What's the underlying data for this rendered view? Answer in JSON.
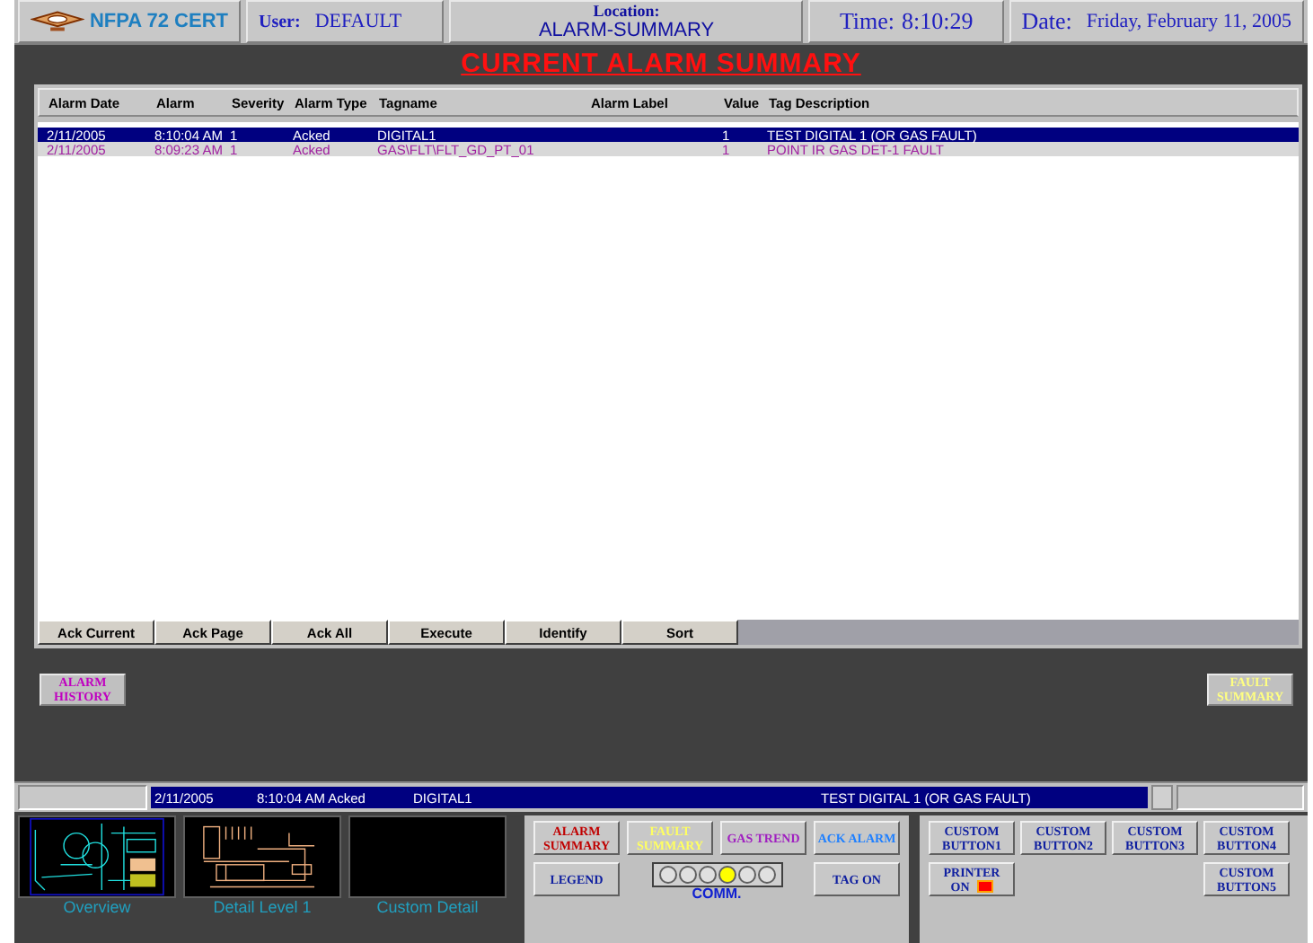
{
  "header": {
    "logo_text": "NFPA 72 CERT",
    "user_label": "User:",
    "user": "DEFAULT",
    "location_label": "Location:",
    "location": "ALARM-SUMMARY",
    "time_label": "Time:",
    "time": "8:10:29",
    "date_label": "Date:",
    "date": "Friday, February 11, 2005"
  },
  "title": "CURRENT ALARM SUMMARY",
  "table": {
    "columns": [
      "Alarm Date",
      "Alarm",
      "Severity",
      "Alarm Type",
      "Tagname",
      "Alarm Label",
      "Value",
      "Tag Description"
    ],
    "rows": [
      {
        "selected": true,
        "cells": [
          "2/11/2005",
          "8:10:04 AM",
          "1",
          "Acked",
          "DIGITAL1",
          "",
          "1",
          "TEST DIGITAL 1 (OR GAS FAULT)"
        ]
      },
      {
        "selected": false,
        "cells": [
          "2/11/2005",
          "8:09:23 AM",
          "1",
          "Acked",
          "GAS\\FLT\\FLT_GD_PT_01",
          "",
          "1",
          "POINT IR GAS DET-1 FAULT"
        ]
      }
    ]
  },
  "table_buttons": [
    "Ack Current",
    "Ack Page",
    "Ack All",
    "Execute",
    "Identify",
    "Sort"
  ],
  "side_buttons": [
    {
      "label": "ALARM HISTORY",
      "color": "#c000c0"
    },
    {
      "label": "FAULT SUMMARY",
      "color": "#ffff80"
    }
  ],
  "status_line": [
    "2/11/2005",
    "8:10:04 AM Acked",
    "DIGITAL1",
    "TEST DIGITAL 1 (OR GAS FAULT)"
  ],
  "thumbnails": [
    "Overview",
    "Detail Level 1",
    "Custom Detail"
  ],
  "nav_buttons": [
    {
      "label": "ALARM SUMMARY",
      "color": "#c00000"
    },
    {
      "label": "FAULT SUMMARY",
      "color": "#ffff60"
    },
    {
      "label": "GAS TREND",
      "color": "#a020c0"
    },
    {
      "label": "ACK ALARM",
      "color": "#2080ff"
    },
    {
      "label": "LEGEND",
      "color": "#1020a0"
    },
    {
      "label": "TAG ON",
      "color": "#1020a0"
    }
  ],
  "comm": {
    "label": "COMM.",
    "lights": [
      {
        "on": false
      },
      {
        "on": false
      },
      {
        "on": false
      },
      {
        "on": true
      },
      {
        "on": false
      },
      {
        "on": false
      }
    ]
  },
  "custom_buttons": [
    "CUSTOM BUTTON1",
    "CUSTOM BUTTON2",
    "CUSTOM BUTTON3",
    "CUSTOM BUTTON4"
  ],
  "printer_button": "PRINTER ON",
  "custom_button_5": "CUSTOM BUTTON5"
}
